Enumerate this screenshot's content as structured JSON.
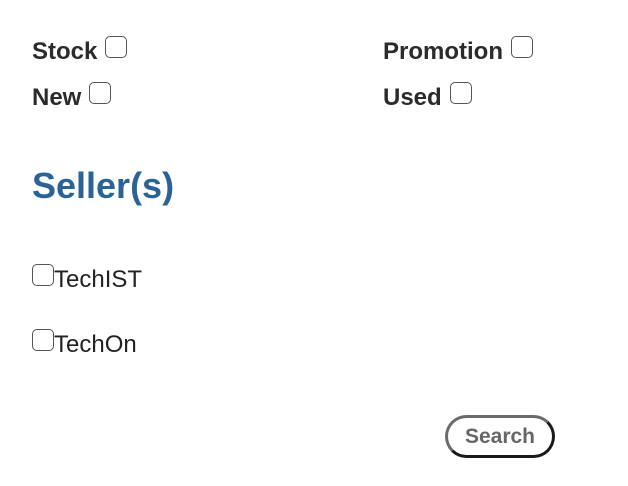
{
  "filters": {
    "stock": {
      "label": "Stock",
      "checked": false
    },
    "new": {
      "label": "New",
      "checked": false
    },
    "promotion": {
      "label": "Promotion",
      "checked": false
    },
    "used": {
      "label": "Used",
      "checked": false
    }
  },
  "sellers": {
    "title": "Seller(s)",
    "items": [
      {
        "label": "TechIST",
        "checked": false
      },
      {
        "label": "TechOn",
        "checked": false
      }
    ]
  },
  "actions": {
    "search_label": "Search"
  }
}
